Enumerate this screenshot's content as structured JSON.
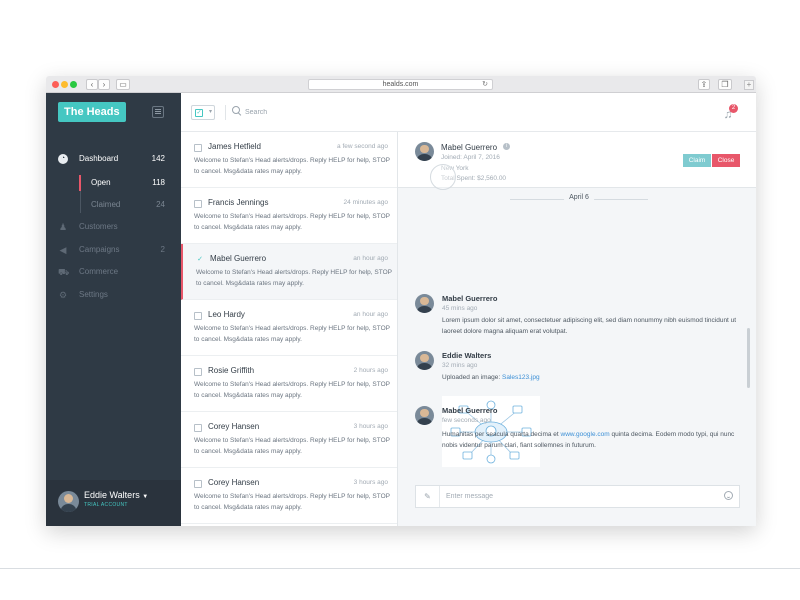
{
  "browser": {
    "url": "healds.com"
  },
  "sidebar": {
    "logo_text": "The Heads",
    "items": [
      {
        "label": "Dashboard",
        "count": "142",
        "icon": "dashboard-icon"
      },
      {
        "label": "Customers",
        "count": "",
        "icon": "customers-icon"
      },
      {
        "label": "Campaigns",
        "count": "2",
        "icon": "megaphone-icon"
      },
      {
        "label": "Commerce",
        "count": "",
        "icon": "cart-icon"
      },
      {
        "label": "Settings",
        "count": "",
        "icon": "gear-icon"
      }
    ],
    "sub_items": [
      {
        "label": "Open",
        "count": "118"
      },
      {
        "label": "Claimed",
        "count": "24"
      }
    ],
    "user": {
      "name": "Eddie Walters",
      "role": "TRIAL ACCOUNT"
    }
  },
  "toolbar": {
    "search_placeholder": "Search",
    "notification_count": "2"
  },
  "messages": [
    {
      "name": "James Hetfield",
      "time": "a few second ago",
      "body": "Welcome to Stefan's Head alerts/drops. Reply HELP for help, STOP to cancel. Msg&data rates may apply.",
      "checked": false
    },
    {
      "name": "Francis Jennings",
      "time": "24 minutes ago",
      "body": "Welcome to Stefan's Head alerts/drops. Reply HELP for help, STOP to cancel. Msg&data rates may apply.",
      "checked": false
    },
    {
      "name": "Mabel Guerrero",
      "time": "an hour ago",
      "body": "Welcome to Stefan's Head alerts/drops. Reply HELP for help, STOP to cancel. Msg&data rates may apply.",
      "checked": true
    },
    {
      "name": "Leo Hardy",
      "time": "an hour ago",
      "body": "Welcome to Stefan's Head alerts/drops. Reply HELP for help, STOP to cancel. Msg&data rates may apply.",
      "checked": false
    },
    {
      "name": "Rosie Griffith",
      "time": "2 hours ago",
      "body": "Welcome to Stefan's Head alerts/drops. Reply HELP for help, STOP to cancel. Msg&data rates may apply.",
      "checked": false
    },
    {
      "name": "Corey Hansen",
      "time": "3 hours ago",
      "body": "Welcome to Stefan's Head alerts/drops. Reply HELP for help, STOP to cancel. Msg&data rates may apply.",
      "checked": false
    },
    {
      "name": "Corey Hansen",
      "time": "3 hours ago",
      "body": "Welcome to Stefan's Head alerts/drops. Reply HELP for help, STOP to cancel. Msg&data rates may apply.",
      "checked": false
    }
  ],
  "conversation": {
    "contact": {
      "name": "Mabel Guerrero",
      "joined": "Joined: April 7, 2016",
      "city": "New York",
      "spent": "Total Spent: $2,560.00"
    },
    "claim_label": "Claim",
    "close_label": "Close",
    "date_label": "April 6",
    "thread": [
      {
        "name": "Mabel Guerrero",
        "time": "45 mins ago",
        "text": "Lorem ipsum dolor sit amet, consectetuer adipiscing elit, sed diam nonummy nibh euismod tincidunt ut laoreet dolore magna aliquam erat volutpat."
      },
      {
        "name": "Eddie Walters",
        "time": "32 mins ago",
        "text_prefix": "Uploaded an image: ",
        "link": "Sales123.jpg"
      },
      {
        "name": "Mabel Guerrero",
        "time": "few seconds ago",
        "text_prefix": "Humanitas per seacula quarta decima et ",
        "link": "www.google.com",
        "text_suffix": " quinta decima. Eodem modo typi, qui nunc nobis videntur parum clari, fiant sollemnes in futurum."
      }
    ],
    "compose_placeholder": "Enter message"
  },
  "colors": {
    "accent": "#45c7c2",
    "danger": "#e8576a",
    "sidebar_bg": "#2f3a45",
    "link": "#3b8fd6"
  }
}
